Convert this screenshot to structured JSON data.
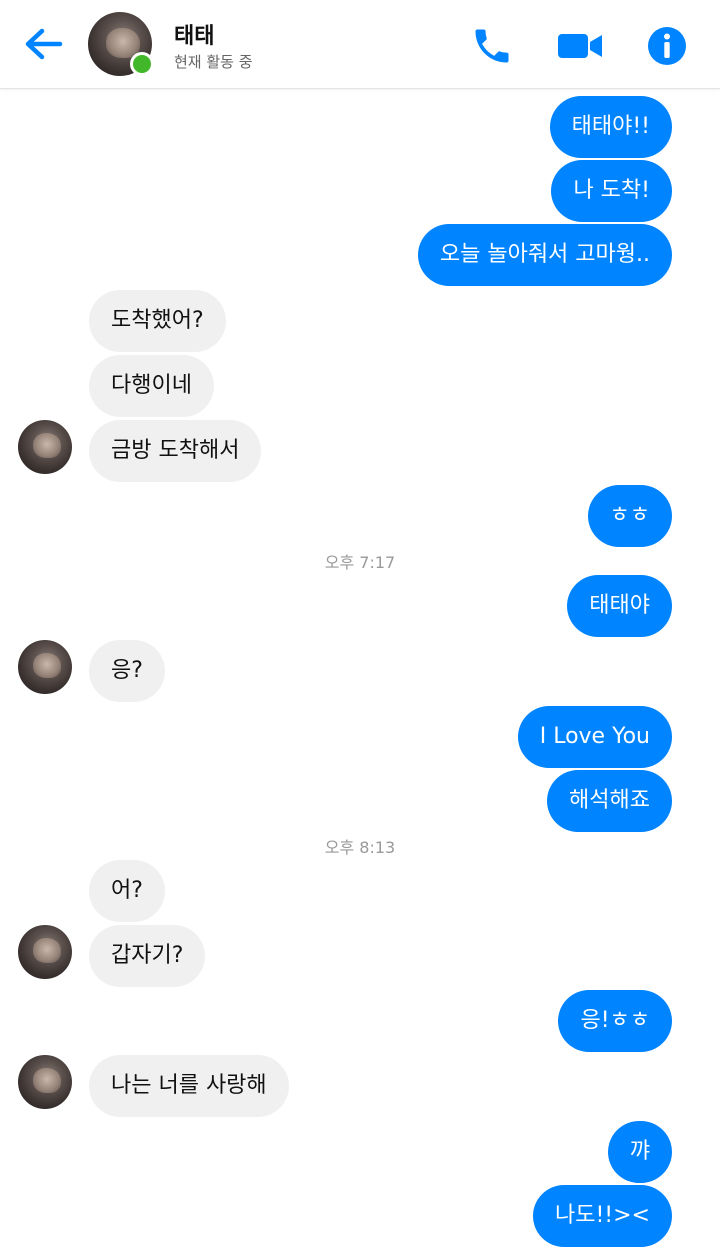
{
  "header": {
    "name": "태태",
    "status": "현재 활동 중"
  },
  "colors": {
    "accent": "#0084ff",
    "received_bubble": "#f0f0f0",
    "online": "#42b72a"
  },
  "icons": [
    "back-arrow-icon",
    "phone-icon",
    "video-camera-icon",
    "info-icon"
  ],
  "messages": [
    {
      "from": "me",
      "text": "태태야!!"
    },
    {
      "from": "me",
      "text": "나 도착!"
    },
    {
      "from": "me",
      "text": "오늘 놀아줘서 고마웡.."
    },
    {
      "from": "them",
      "text": "도착했어?"
    },
    {
      "from": "them",
      "text": "다행이네"
    },
    {
      "from": "them",
      "text": "금방 도착해서"
    },
    {
      "from": "me",
      "text": "ㅎㅎ"
    },
    {
      "from": "me",
      "text": "태태야"
    },
    {
      "from": "them",
      "text": "응?"
    },
    {
      "from": "me",
      "text": "I Love You"
    },
    {
      "from": "me",
      "text": "해석해죠"
    },
    {
      "from": "them",
      "text": "어?"
    },
    {
      "from": "them",
      "text": "갑자기?"
    },
    {
      "from": "me",
      "text": "응!ㅎㅎ"
    },
    {
      "from": "them",
      "text": "나는 너를 사랑해"
    },
    {
      "from": "me",
      "text": "꺄"
    },
    {
      "from": "me",
      "text": "나도!!><"
    }
  ],
  "timestamps": [
    "오후 7:17",
    "오후 8:13"
  ]
}
